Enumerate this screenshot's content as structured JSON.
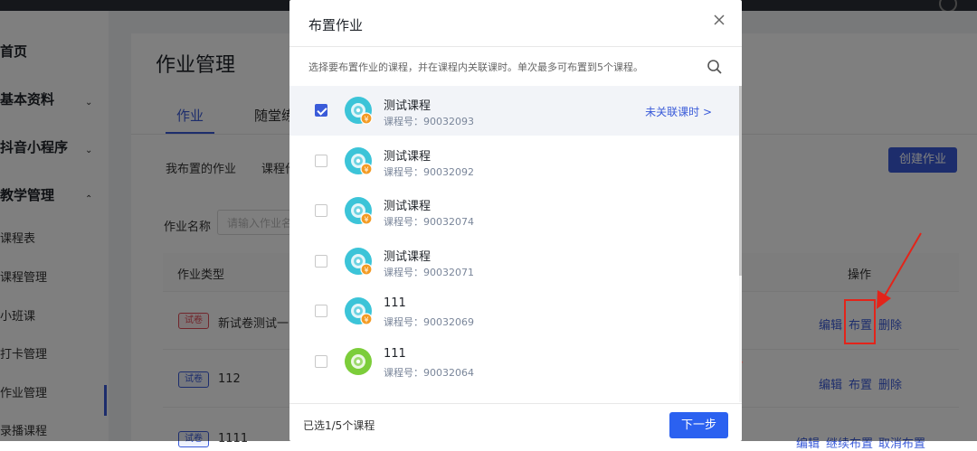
{
  "background": {
    "sidebar": {
      "items": [
        {
          "label": "首页",
          "level": 1
        },
        {
          "label": "基本资料",
          "level": 1,
          "arrow": "⌄"
        },
        {
          "label": "抖音小程序",
          "level": 1,
          "arrow": "⌄"
        },
        {
          "label": "教学管理",
          "level": 1,
          "arrow": "⌃"
        },
        {
          "label": "课程表",
          "level": 2
        },
        {
          "label": "课程管理",
          "level": 2
        },
        {
          "label": "小班课",
          "level": 2
        },
        {
          "label": "打卡管理",
          "level": 2
        },
        {
          "label": "作业管理",
          "level": 2
        },
        {
          "label": "录播课程",
          "level": 2
        }
      ]
    },
    "page_title": "作业管理",
    "tabs": [
      "作业",
      "随堂练"
    ],
    "subtabs": [
      "我布置的作业",
      "课程作"
    ],
    "create_button": "创建作业",
    "filter": {
      "label": "作业名称",
      "placeholder": "请输入作业名"
    },
    "table": {
      "headers": [
        "作业类型",
        "操作"
      ],
      "rows": [
        {
          "tag": "试卷",
          "tag_color": "red",
          "name": "新试卷测试一",
          "ops": [
            "编辑",
            "布置",
            "删除"
          ]
        },
        {
          "tag": "试卷",
          "tag_color": "blue",
          "name": "112",
          "ops": [
            "编辑",
            "布置",
            "删除"
          ]
        },
        {
          "tag": "试卷",
          "tag_color": "blue",
          "name": "1111",
          "ops": [
            "编辑",
            "继续布置",
            "取消布置"
          ]
        }
      ]
    }
  },
  "modal": {
    "title": "布置作业",
    "close_icon": "close-icon",
    "hint": "选择要布置作业的课程，并在课程内关联课时。单次最多可布置到5个课程。",
    "search_icon": "search-icon",
    "link_lesson_label": "未关联课时",
    "link_arrow": ">",
    "courses": [
      {
        "name": "测试课程",
        "code": "课程号：90032093",
        "checked": true,
        "thumb": "cyan",
        "badge": "¥"
      },
      {
        "name": "测试课程",
        "code": "课程号：90032092",
        "checked": false,
        "thumb": "cyan",
        "badge": "¥"
      },
      {
        "name": "测试课程",
        "code": "课程号：90032074",
        "checked": false,
        "thumb": "cyan",
        "badge": "¥"
      },
      {
        "name": "测试课程",
        "code": "课程号：90032071",
        "checked": false,
        "thumb": "cyan",
        "badge": "¥"
      },
      {
        "name": "111",
        "code": "课程号：90032069",
        "checked": false,
        "thumb": "cyan",
        "badge": "¥"
      },
      {
        "name": "111",
        "code": "课程号：90032064",
        "checked": false,
        "thumb": "green",
        "badge": ""
      }
    ],
    "footer_count": "已选1/5个课程",
    "next_button": "下一步"
  },
  "colors": {
    "primary": "#3a5bd9",
    "next_button": "#2b61f0",
    "annotation_red": "#e3241a",
    "thumb_cyan": "#3cc4d8",
    "thumb_green": "#7ccd3a",
    "badge_orange": "#f39b24"
  }
}
